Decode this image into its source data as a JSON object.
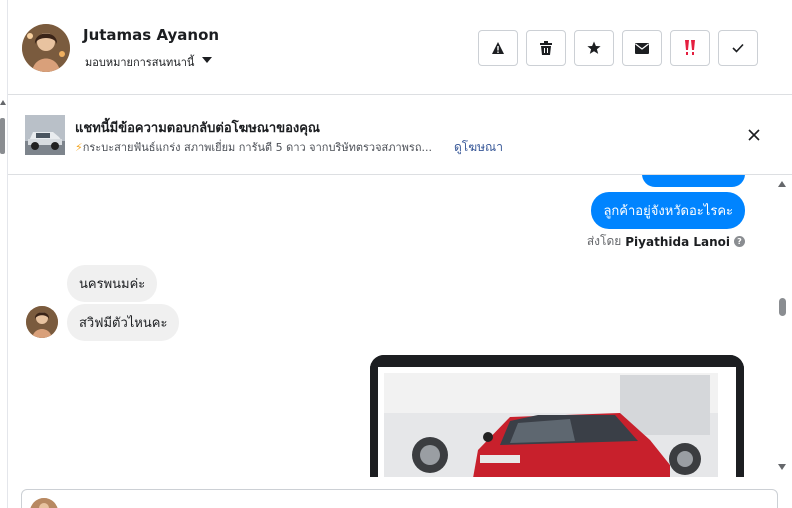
{
  "header": {
    "name": "Jutamas Ayanon",
    "assign_label": "มอบหมายการสนทนานี้",
    "actions": [
      {
        "icon": "warning-icon"
      },
      {
        "icon": "trash-icon"
      },
      {
        "icon": "star-icon"
      },
      {
        "icon": "envelope-icon"
      },
      {
        "icon": "double-exclamation-icon"
      },
      {
        "icon": "checkmark-icon"
      }
    ]
  },
  "ad_banner": {
    "title": "แชทนี้มีข้อความตอบกลับต่อโฆษณาของคุณ",
    "subtitle_prefix": "⚡",
    "subtitle": "กระบะสายฟันธ์แกร่ง สภาพเยี่ยม การันตี 5 ดาว จากบริษัทตรวจสภาพรถ...",
    "link": "ดูโฆษณา"
  },
  "messages": {
    "outgoing": [
      "ลูกค้าอยู่จังหวัดอะไรคะ"
    ],
    "sent_by_label": "ส่งโดย",
    "sent_by_name": "Piyathida Lanoi",
    "incoming": [
      "นครพนมค่ะ",
      "สวิฟมีตัวไหนคะ"
    ]
  },
  "colors": {
    "outgoing_bubble": "#0084ff",
    "incoming_bubble": "#f0f0f0",
    "link": "#385898",
    "alert_icon": "#e41e3f"
  }
}
